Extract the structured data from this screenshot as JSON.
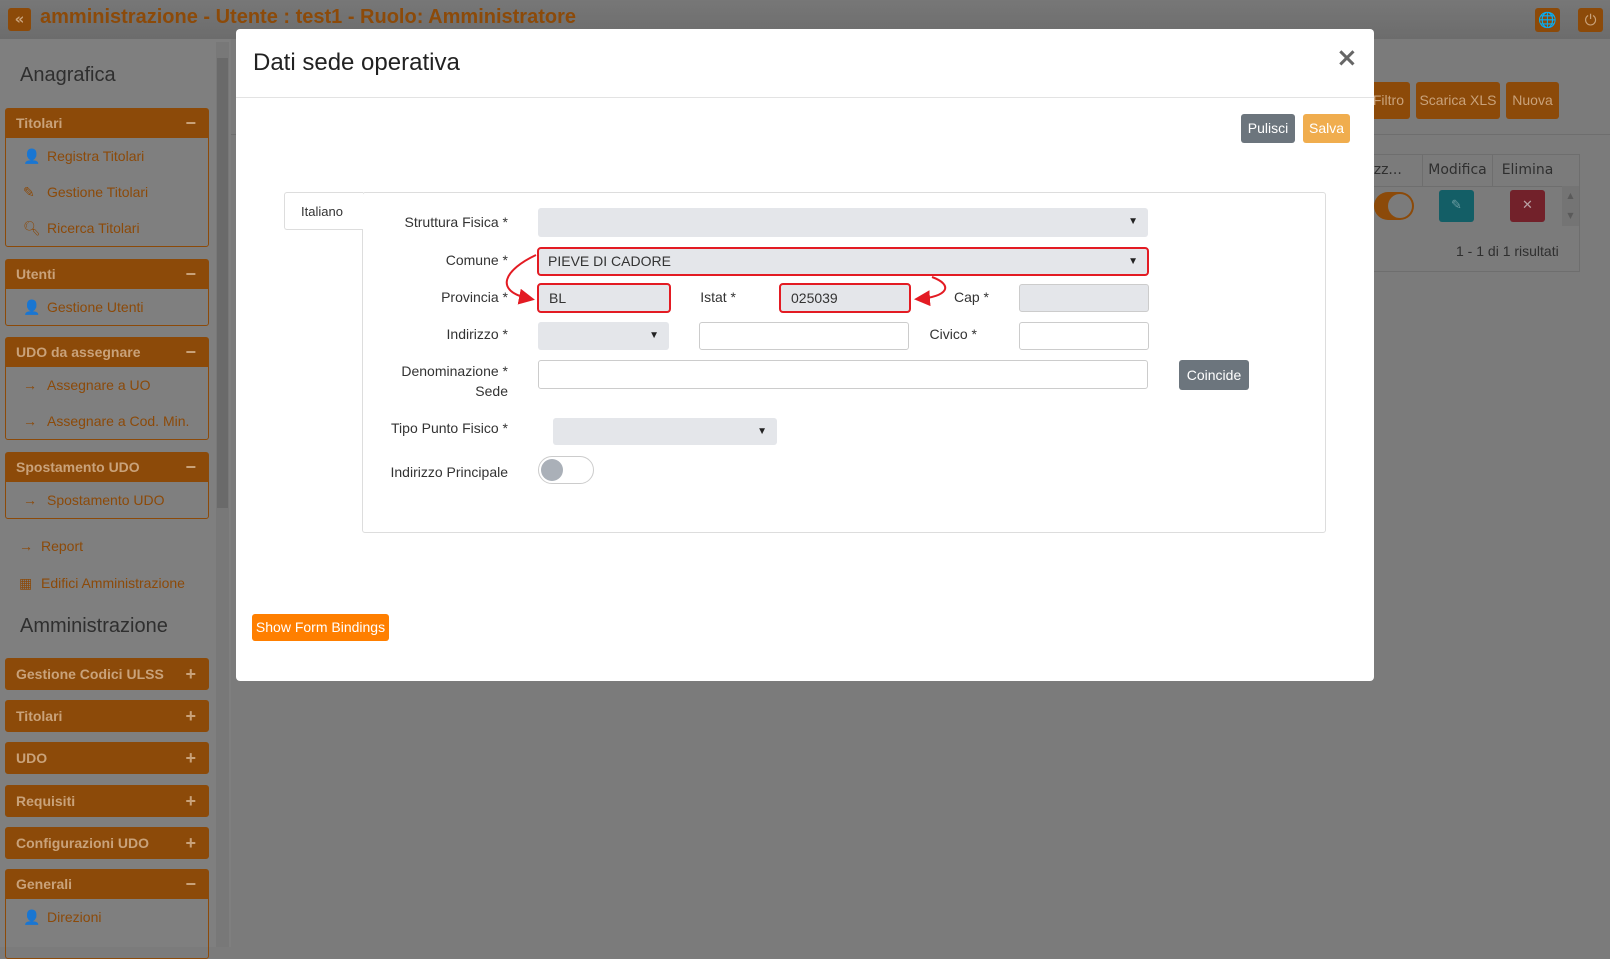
{
  "app": {
    "title": "amministrazione - Utente : test1 - Ruolo: Amministratore",
    "collapse_icon": "double-chevron-left",
    "globe_icon": "globe",
    "power_icon": "power"
  },
  "sidebar": {
    "section1": "Anagrafica",
    "groups1": [
      {
        "title": "Titolari",
        "sign": "−",
        "items": [
          {
            "label": "Registra Titolari",
            "icon": "user-edit"
          },
          {
            "label": "Gestione Titolari",
            "icon": "edit"
          },
          {
            "label": "Ricerca Titolari",
            "icon": "search"
          }
        ]
      },
      {
        "title": "Utenti",
        "sign": "−",
        "items": [
          {
            "label": "Gestione Utenti",
            "icon": "user-edit"
          }
        ]
      },
      {
        "title": "UDO da assegnare",
        "sign": "−",
        "items": [
          {
            "label": "Assegnare a UO",
            "icon": "arrow-right"
          },
          {
            "label": "Assegnare a Cod. Min.",
            "icon": "arrow-right"
          }
        ]
      },
      {
        "title": "Spostamento UDO",
        "sign": "−",
        "items": [
          {
            "label": "Spostamento UDO",
            "icon": "arrow-right"
          }
        ]
      }
    ],
    "links": [
      {
        "label": "Report",
        "icon": "arrow-right"
      },
      {
        "label": "Edifici Amministrazione",
        "icon": "building"
      }
    ],
    "section2": "Amministrazione",
    "groups2": [
      {
        "title": "Gestione Codici ULSS",
        "sign": "+"
      },
      {
        "title": "Titolari",
        "sign": "+"
      },
      {
        "title": "UDO",
        "sign": "+"
      },
      {
        "title": "Requisiti",
        "sign": "+"
      },
      {
        "title": "Configurazioni UDO",
        "sign": "+"
      },
      {
        "title": "Generali",
        "sign": "−",
        "items": [
          {
            "label": "Direzioni",
            "icon": "user-edit"
          }
        ]
      }
    ]
  },
  "background": {
    "buttons": {
      "filtro": "Filtro",
      "scarica": "Scarica XLS",
      "nuova": "Nuova"
    },
    "table": {
      "columns": [
        "irizz...",
        "Modifica",
        "Elimina"
      ],
      "results": "1 - 1 di 1 risultati",
      "toggle_on": true
    }
  },
  "modal": {
    "title": "Dati sede operativa",
    "close": "×",
    "pulisci": "Pulisci",
    "salva": "Salva",
    "tab": "Italiano",
    "fields": {
      "struttura": {
        "label": "Struttura Fisica *",
        "value": ""
      },
      "comune": {
        "label": "Comune *",
        "value": "PIEVE DI CADORE"
      },
      "provincia": {
        "label": "Provincia *",
        "value": "BL"
      },
      "istat": {
        "label": "Istat *",
        "value": "025039"
      },
      "cap": {
        "label": "Cap *",
        "value": ""
      },
      "indirizzo": {
        "label": "Indirizzo *",
        "value": ""
      },
      "civico": {
        "label": "Civico *",
        "value": ""
      },
      "denominazione": {
        "label1": "Denominazione *",
        "label2": "Sede",
        "value": ""
      },
      "tipo": {
        "label": "Tipo Punto Fisico *",
        "value": ""
      },
      "principale": {
        "label": "Indirizzo Principale",
        "value": false
      }
    },
    "coincide": "Coincide",
    "show_bindings": "Show Form Bindings"
  },
  "colors": {
    "brand": "#e07b0f",
    "highlight": "#e31b23",
    "salva": "#f0ad4e",
    "bindings": "#ff7f00",
    "secondary": "#6c757d"
  }
}
